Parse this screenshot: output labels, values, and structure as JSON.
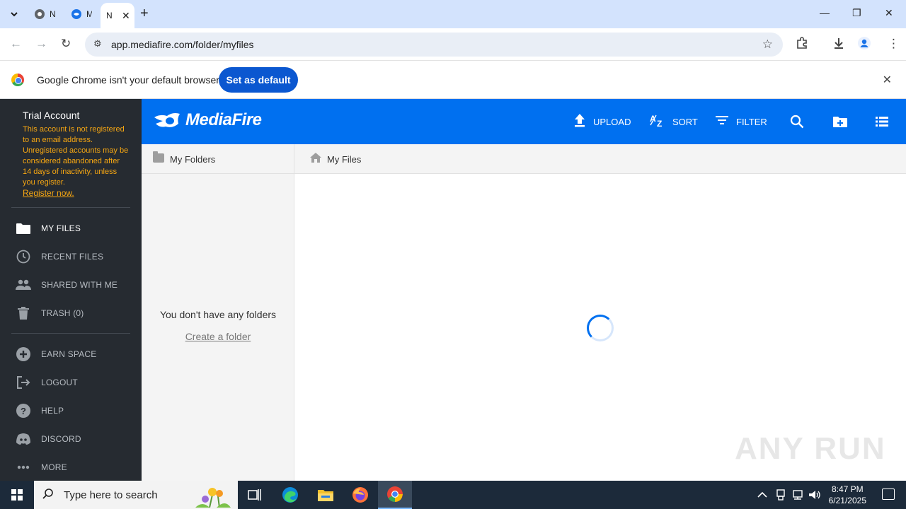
{
  "browser": {
    "tabs": [
      {
        "label": "N",
        "icon": "chrome-globe-icon"
      },
      {
        "label": "M",
        "icon": "mediafire-icon"
      },
      {
        "label": "N",
        "icon": "mediafire-icon",
        "active": true
      }
    ],
    "url": "app.mediafire.com/folder/myfiles",
    "infobar": {
      "message": "Google Chrome isn't your default browser",
      "button": "Set as default"
    }
  },
  "sidebar": {
    "account_title": "Trial Account",
    "account_note": "This account is not registered to an email address. Unregistered accounts may be considered abandoned after 14 days of inactivity, unless you register.",
    "register_link": "Register now.",
    "items": [
      {
        "label": "MY FILES",
        "icon": "folder-icon",
        "active": true
      },
      {
        "label": "RECENT FILES",
        "icon": "clock-icon"
      },
      {
        "label": "SHARED WITH ME",
        "icon": "people-icon"
      },
      {
        "label": "TRASH (0)",
        "icon": "trash-icon"
      },
      {
        "label": "EARN SPACE",
        "icon": "plus-circle-icon"
      },
      {
        "label": "LOGOUT",
        "icon": "logout-icon"
      },
      {
        "label": "HELP",
        "icon": "help-icon"
      },
      {
        "label": "DISCORD",
        "icon": "discord-icon"
      },
      {
        "label": "MORE",
        "icon": "more-dots-icon"
      }
    ]
  },
  "header": {
    "brand": "MediaFire",
    "upload": "UPLOAD",
    "sort": "SORT",
    "filter": "FILTER"
  },
  "folders": {
    "title": "My Folders",
    "empty": "You don't have any folders",
    "create": "Create a folder"
  },
  "files": {
    "breadcrumb": "My Files"
  },
  "watermark": "ANY RUN",
  "taskbar": {
    "search_placeholder": "Type here to search",
    "time": "8:47 PM",
    "date": "6/21/2025"
  },
  "colors": {
    "mediafire_blue": "#0070f0",
    "sidebar_bg": "#262b31",
    "warning": "#f7a712",
    "chrome_button": "#0b57d0"
  }
}
